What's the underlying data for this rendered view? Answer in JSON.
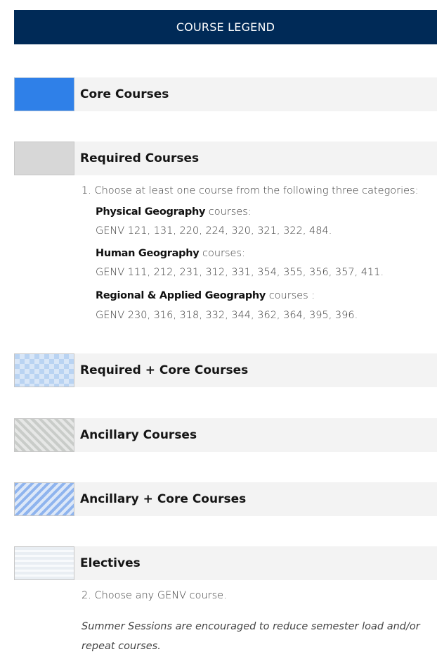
{
  "header": {
    "title": "COURSE LEGEND"
  },
  "legend": [
    {
      "label": "Core Courses",
      "swatch": "solid-blue",
      "color": "#2f80e8"
    },
    {
      "label": "Required Courses",
      "swatch": "solid-gray",
      "color": "#d7d7d7"
    },
    {
      "label": "Required + Core Courses",
      "swatch": "checker-blue"
    },
    {
      "label": "Ancillary Courses",
      "swatch": "diagonal-gray"
    },
    {
      "label": "Ancillary + Core Courses",
      "swatch": "diagonal-blue"
    },
    {
      "label": "Electives",
      "swatch": "horizontal-lines"
    }
  ],
  "required_notes": {
    "intro": "1. Choose at least one course from the following three categories:",
    "categories": [
      {
        "title": "Physical Geography",
        "suffix": " courses:",
        "courses": "GENV 121, 131, 220, 224, 320, 321, 322, 484."
      },
      {
        "title": "Human Geography",
        "suffix": " courses:",
        "courses": "GENV 111, 212, 231, 312, 331, 354, 355, 356, 357, 411."
      },
      {
        "title": "Regional & Applied Geography",
        "suffix": " courses :",
        "courses": "GENV 230, 316, 318, 332, 344, 362, 364, 395, 396."
      }
    ]
  },
  "electives_note": "2. Choose any GENV course.",
  "summer_note_line1": "Summer Sessions are encouraged to reduce semester load and/or",
  "summer_note_line2": "repeat courses."
}
